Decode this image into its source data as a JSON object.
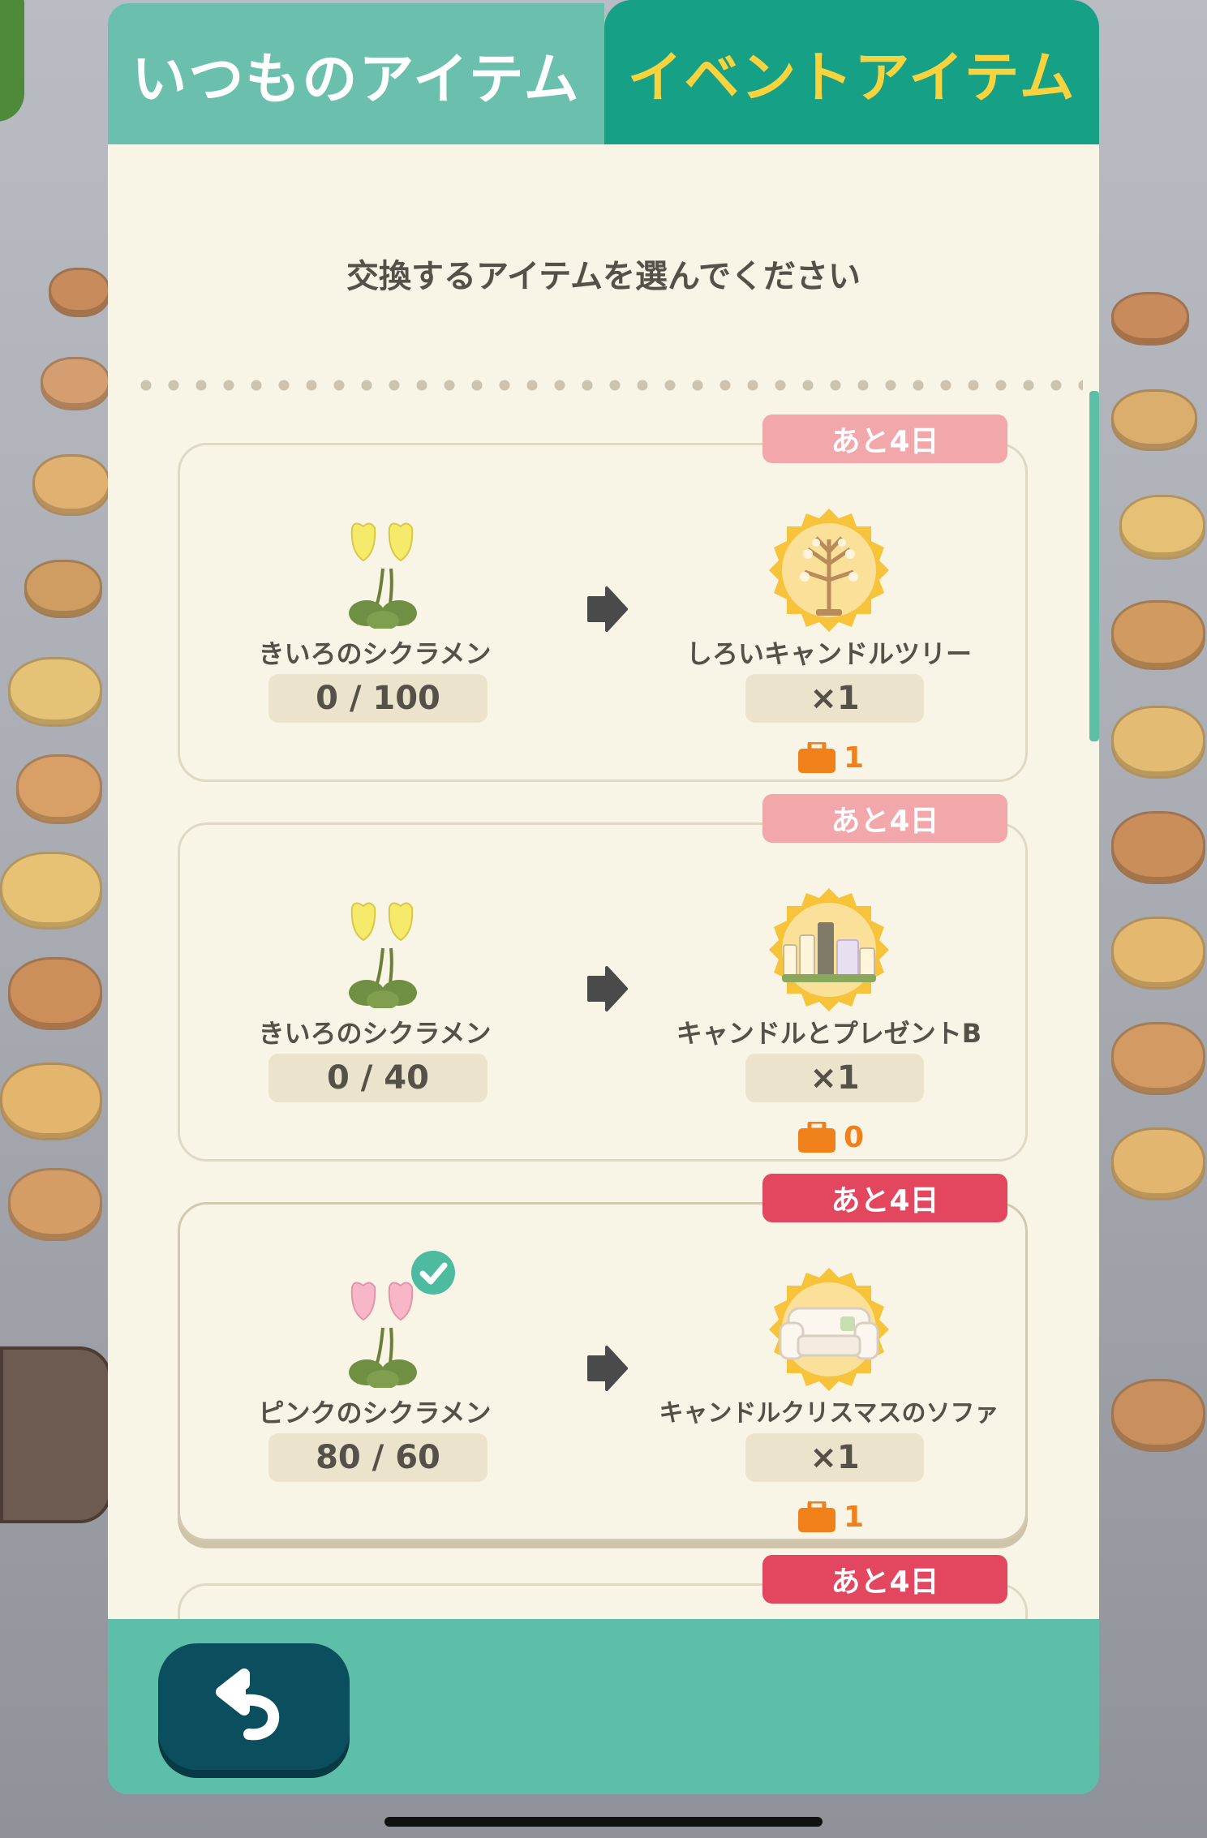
{
  "tabs": {
    "regular": "いつものアイテム",
    "event": "イベントアイテム",
    "active": "event"
  },
  "instruction": "交換するアイテムを選んでください",
  "items": [
    {
      "badge": "あと4日",
      "required_item": "きいろのシクラメン",
      "required_count": "0 / 100",
      "flower_color": "#f6ea6b",
      "reward_item": "しろいキャンドルツリー",
      "reward_quantity": "×1",
      "inventory_count": "1",
      "inventory_icon": "briefcase-icon",
      "selected": false
    },
    {
      "badge": "あと4日",
      "required_item": "きいろのシクラメン",
      "required_count": "0 / 40",
      "flower_color": "#f6ea6b",
      "reward_item": "キャンドルとプレゼントB",
      "reward_quantity": "×1",
      "inventory_count": "0",
      "inventory_icon": "briefcase-icon",
      "selected": false
    },
    {
      "badge": "あと4日",
      "required_item": "ピンクのシクラメン",
      "required_count": "80 / 60",
      "flower_color": "#f8b7c8",
      "reward_item": "キャンドルクリスマスのソファ",
      "reward_quantity": "×1",
      "inventory_count": "1",
      "inventory_icon": "briefcase-icon",
      "selected": true
    },
    {
      "badge": "あと4日"
    }
  ],
  "colors": {
    "tab_regular": "#6bc0ad",
    "tab_event": "#16a085",
    "tab_event_text": "#f7d33e",
    "badge_pale": "#f2a7ab",
    "badge_strong": "#e2475f",
    "footer": "#5dbfa8",
    "back_button": "#0b4f5e",
    "inventory": "#f0801a"
  },
  "footer": {
    "back_icon": "back-arrow-icon"
  }
}
